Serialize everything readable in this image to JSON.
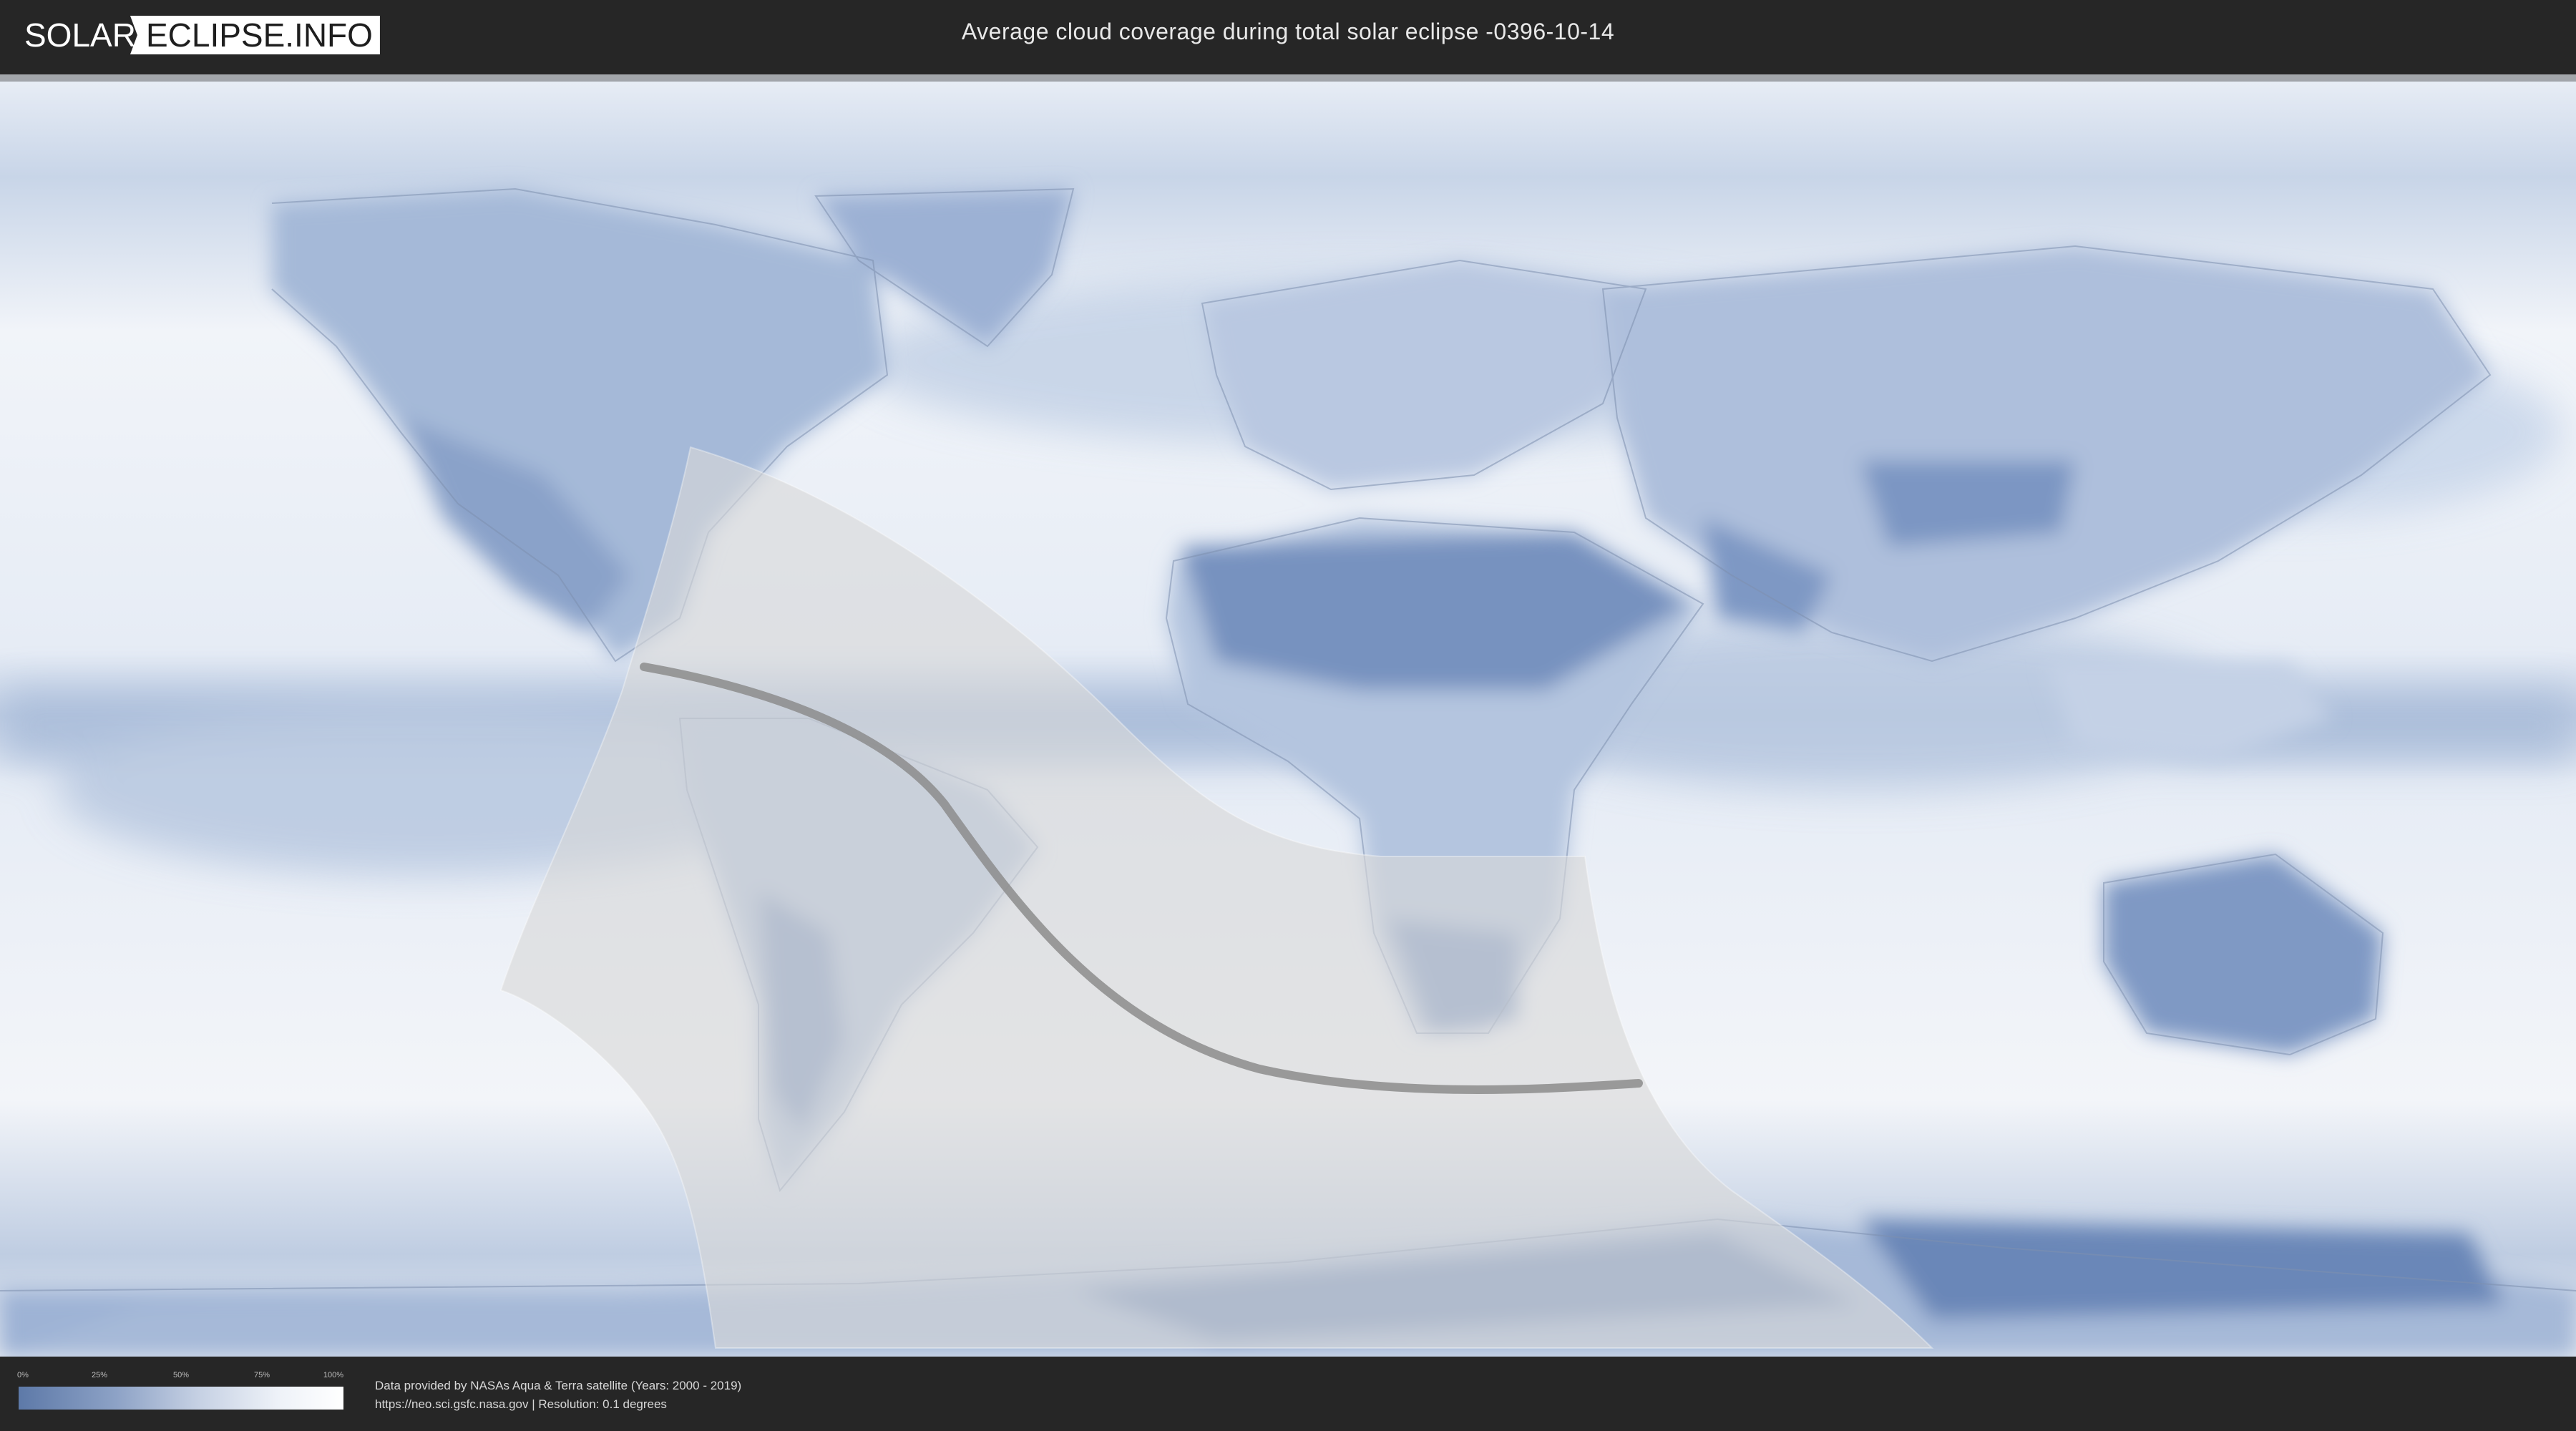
{
  "header": {
    "logo_left": "SOLAR",
    "logo_right": "ECLIPSE.INFO",
    "title": "Average cloud coverage during total solar eclipse -0396-10-14"
  },
  "map": {
    "kind": "equirectangular world cloud-coverage map",
    "eclipse_overlay": "visibility region with central path",
    "colors": {
      "ocean_cloudy": "#dfe7f2",
      "clear_sky": "#5c78a6",
      "overlay": "#d9d9d9",
      "central_path": "#8c8c8c"
    }
  },
  "legend": {
    "ticks": [
      "0%",
      "25%",
      "50%",
      "75%",
      "100%"
    ],
    "colors": {
      "low": "#5d79a8",
      "high": "#ffffff"
    }
  },
  "credits": {
    "line1": "Data provided by NASAs Aqua & Terra satellite (Years: 2000 - 2019)",
    "line2": "https://neo.sci.gsfc.nasa.gov | Resolution: 0.1 degrees"
  }
}
